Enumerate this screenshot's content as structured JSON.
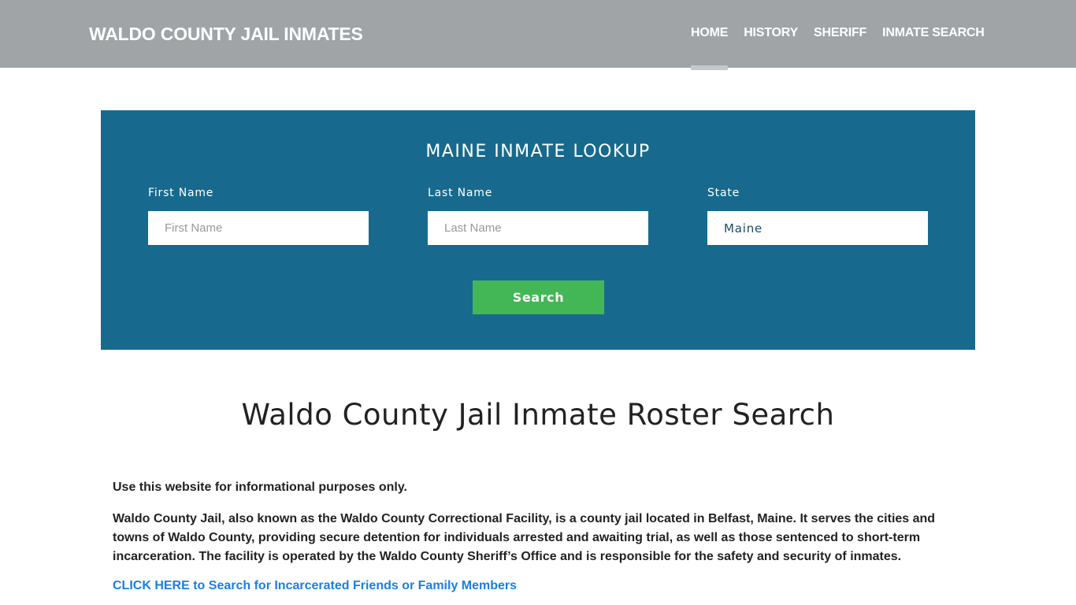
{
  "header": {
    "brand": "WALDO COUNTY JAIL INMATES",
    "nav": [
      {
        "label": "HOME",
        "active": true
      },
      {
        "label": "HISTORY",
        "active": false
      },
      {
        "label": "SHERIFF",
        "active": false
      },
      {
        "label": "INMATE SEARCH",
        "active": false
      }
    ]
  },
  "lookup": {
    "title": "MAINE INMATE LOOKUP",
    "fields": {
      "first_name": {
        "label": "First Name",
        "placeholder": "First Name",
        "value": ""
      },
      "last_name": {
        "label": "Last Name",
        "placeholder": "Last Name",
        "value": ""
      },
      "state": {
        "label": "State",
        "value": "Maine"
      }
    },
    "search_label": "Search"
  },
  "main": {
    "title": "Waldo County Jail Inmate Roster Search",
    "disclaimer": "Use this website for informational purposes only.",
    "description": "Waldo County Jail, also known as the Waldo County Correctional Facility, is a county jail located in Belfast, Maine. It serves the cities and towns of Waldo County, providing secure detention for individuals arrested and awaiting trial, as well as those sentenced to short-term incarceration. The facility is operated by the Waldo County Sheriff’s Office and is responsible for the safety and security of inmates.",
    "cta_link": "CLICK HERE to Search for Incarcerated Friends or Family Members"
  },
  "colors": {
    "navbar": "#a0a4a7",
    "lookup_bg": "#176a8d",
    "search_button": "#43b756",
    "link": "#1a7fe0"
  }
}
